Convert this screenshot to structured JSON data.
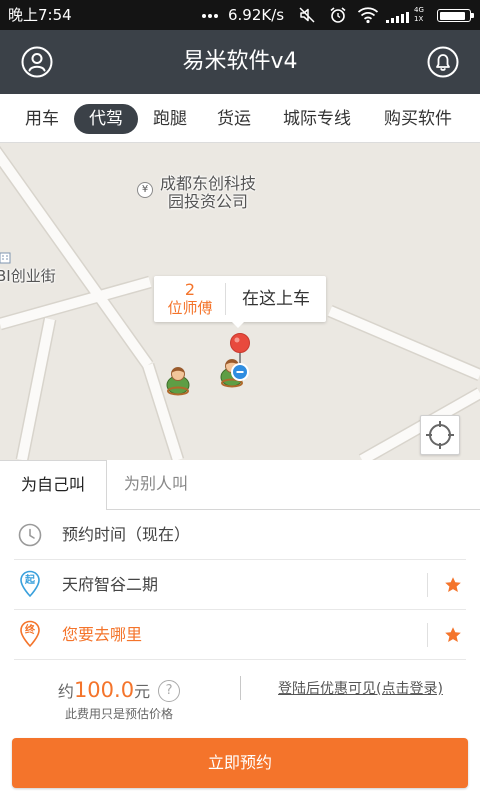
{
  "status_bar": {
    "time": "晚上7:54",
    "speed": "6.92K/s",
    "net_top": "4G",
    "net_bottom": "1X",
    "battery_level": 0.9,
    "icons": [
      "more-dots-icon",
      "mute-icon",
      "alarm-icon",
      "wifi-icon",
      "signal-icon",
      "battery-icon"
    ]
  },
  "header": {
    "title": "易米软件v4",
    "left_icon": "user-icon",
    "right_icon": "bell-icon"
  },
  "tabs": [
    {
      "label": "用车",
      "active": false
    },
    {
      "label": "代驾",
      "active": true
    },
    {
      "label": "跑腿",
      "active": false
    },
    {
      "label": "货运",
      "active": false
    },
    {
      "label": "城际专线",
      "active": false
    },
    {
      "label": "购买软件",
      "active": false
    }
  ],
  "map": {
    "poi": {
      "icon": "¥",
      "line1": "成都东创科技",
      "line2": "园投资公司"
    },
    "street": "BI创业街",
    "callout": {
      "count": "2",
      "unit": "位师傅",
      "action": "在这上车"
    },
    "locate_icon": "crosshair-icon"
  },
  "order": {
    "mode_tabs": [
      {
        "label": "为自己叫",
        "active": true
      },
      {
        "label": "为别人叫",
        "active": false
      }
    ],
    "time_row": {
      "icon": "clock-icon",
      "text": "预约时间（现在）"
    },
    "start_row": {
      "badge": "起",
      "text": "天府智谷二期",
      "icon": "star-icon"
    },
    "end_row": {
      "badge": "终",
      "text": "您要去哪里",
      "icon": "star-icon"
    },
    "price": {
      "prefix": "约",
      "amount": "100.0",
      "unit": "元",
      "help": "?",
      "note": "此费用只是预估价格"
    },
    "login_hint": "登陆后优惠可见(点击登录)",
    "submit": "立即预约"
  },
  "colors": {
    "accent": "#f4742b",
    "header_bg": "#3b4148",
    "start_blue": "#3aa0dc",
    "map_bg": "#ebe8e2",
    "pin_red": "#e84a3d"
  }
}
